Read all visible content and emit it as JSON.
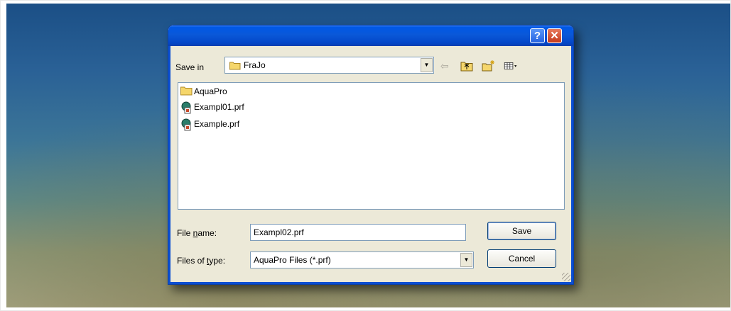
{
  "window": {
    "help_glyph": "?",
    "close_glyph": "✕"
  },
  "save_in": {
    "label": "Save in",
    "value": "FraJo"
  },
  "toolbar": {
    "icons": [
      "back-arrow-icon",
      "up-folder-icon",
      "new-folder-icon",
      "view-menu-icon"
    ]
  },
  "files": [
    {
      "name": "AquaPro",
      "type": "folder"
    },
    {
      "name": "Exampl01.prf",
      "type": "prf"
    },
    {
      "name": "Example.prf",
      "type": "prf"
    }
  ],
  "filename": {
    "label_pre": "File ",
    "label_key": "n",
    "label_post": "ame:",
    "value": "Exampl02.prf"
  },
  "filetype": {
    "label_pre": "Files of ",
    "label_key": "t",
    "label_post": "ype:",
    "value": "AquaPro Files (*.prf)"
  },
  "buttons": {
    "save": "Save",
    "cancel": "Cancel"
  },
  "colors": {
    "titlebar": "#0058e6",
    "dialog_bg": "#ece9d8",
    "close": "#c4391b"
  }
}
